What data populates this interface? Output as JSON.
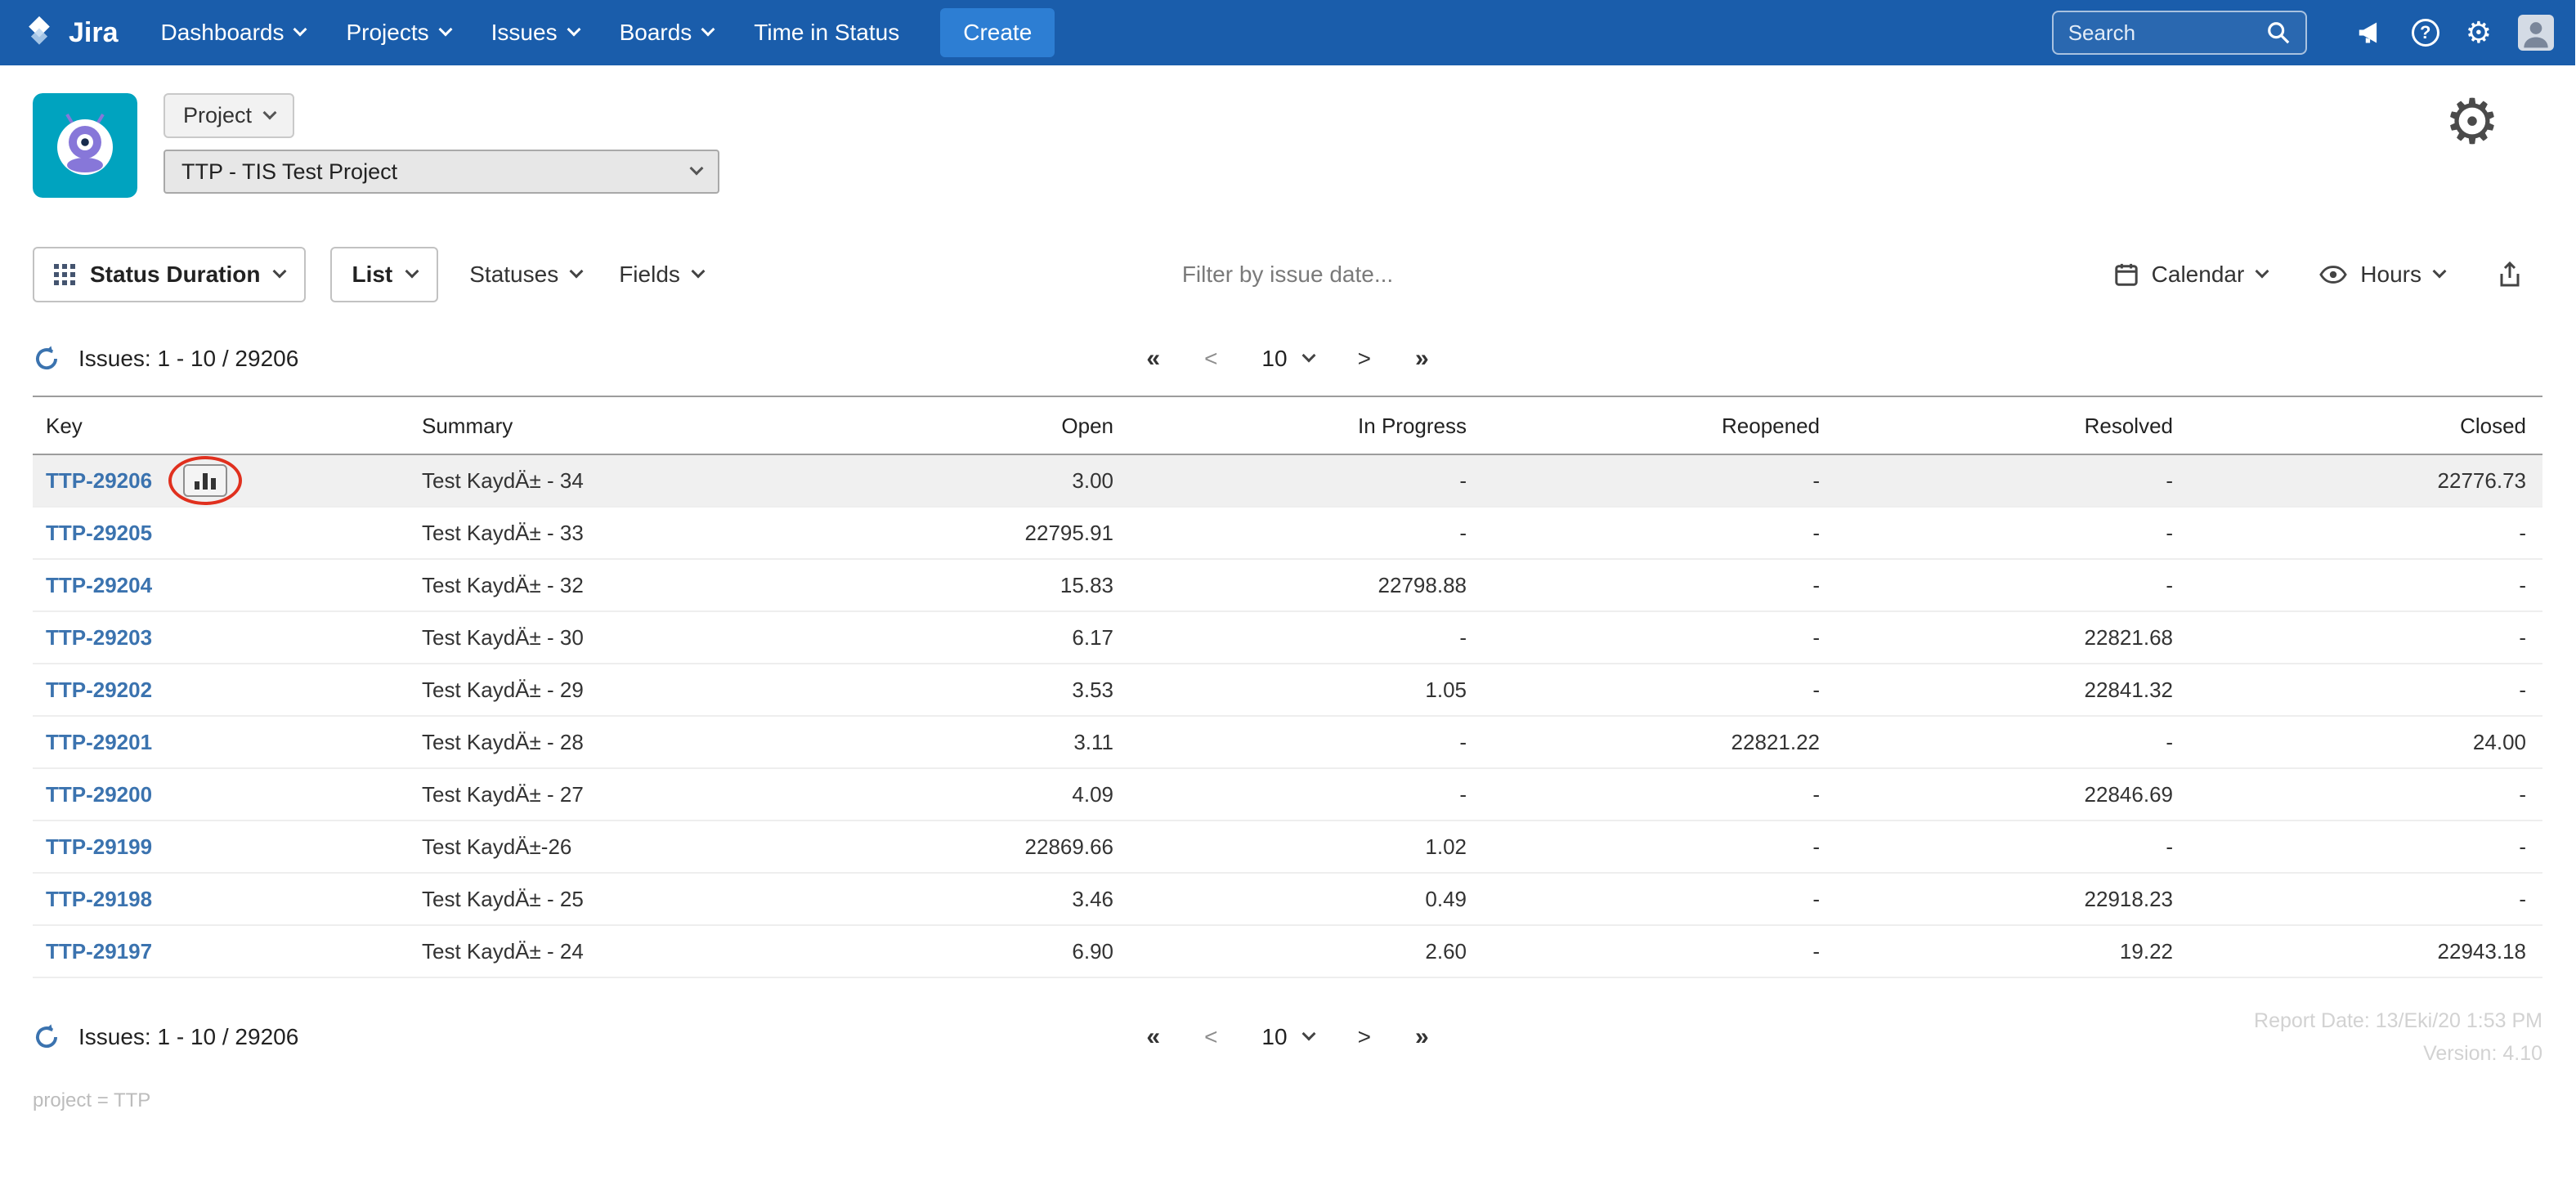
{
  "colors": {
    "navbar_bg": "#1a5dab",
    "create_btn_bg": "#2d7ed3",
    "link": "#3b73af",
    "annotation_red": "#e0301e",
    "row_highlight": "#f0f0f0"
  },
  "navbar": {
    "brand": "Jira",
    "items": [
      {
        "label": "Dashboards"
      },
      {
        "label": "Projects"
      },
      {
        "label": "Issues"
      },
      {
        "label": "Boards"
      },
      {
        "label": "Time in Status"
      }
    ],
    "create_label": "Create",
    "search_placeholder": "Search"
  },
  "icons": {
    "help_glyph": "?",
    "gear_glyph": "⚙",
    "settings_gear_glyph": "⚙"
  },
  "project_header": {
    "scope_label": "Project",
    "selected_project": "TTP - TIS Test Project"
  },
  "toolbar": {
    "report_type": "Status Duration",
    "view": "List",
    "statuses": "Statuses",
    "fields": "Fields",
    "filter_placeholder": "Filter by issue date...",
    "calendar": "Calendar",
    "hours": "Hours"
  },
  "results": {
    "issues_summary": "Issues: 1 - 10 / 29206"
  },
  "pagination": {
    "first": "«",
    "prev": "<",
    "page_size": "10",
    "next": ">",
    "last": "»"
  },
  "table": {
    "columns": [
      "Key",
      "Summary",
      "Open",
      "In Progress",
      "Reopened",
      "Resolved",
      "Closed"
    ],
    "rows": [
      {
        "key": "TTP-29206",
        "summary": "Test KaydÄ± - 34",
        "open": "3.00",
        "in_progress": "-",
        "reopened": "-",
        "resolved": "-",
        "closed": "22776.73",
        "highlighted": true,
        "annotated": true
      },
      {
        "key": "TTP-29205",
        "summary": "Test KaydÄ± - 33",
        "open": "22795.91",
        "in_progress": "-",
        "reopened": "-",
        "resolved": "-",
        "closed": "-"
      },
      {
        "key": "TTP-29204",
        "summary": "Test KaydÄ± - 32",
        "open": "15.83",
        "in_progress": "22798.88",
        "reopened": "-",
        "resolved": "-",
        "closed": "-"
      },
      {
        "key": "TTP-29203",
        "summary": "Test KaydÄ± - 30",
        "open": "6.17",
        "in_progress": "-",
        "reopened": "-",
        "resolved": "22821.68",
        "closed": "-"
      },
      {
        "key": "TTP-29202",
        "summary": "Test KaydÄ± - 29",
        "open": "3.53",
        "in_progress": "1.05",
        "reopened": "-",
        "resolved": "22841.32",
        "closed": "-"
      },
      {
        "key": "TTP-29201",
        "summary": "Test KaydÄ± - 28",
        "open": "3.11",
        "in_progress": "-",
        "reopened": "22821.22",
        "resolved": "-",
        "closed": "24.00"
      },
      {
        "key": "TTP-29200",
        "summary": "Test KaydÄ± - 27",
        "open": "4.09",
        "in_progress": "-",
        "reopened": "-",
        "resolved": "22846.69",
        "closed": "-"
      },
      {
        "key": "TTP-29199",
        "summary": "Test KaydÄ±-26",
        "open": "22869.66",
        "in_progress": "1.02",
        "reopened": "-",
        "resolved": "-",
        "closed": "-"
      },
      {
        "key": "TTP-29198",
        "summary": "Test KaydÄ± - 25",
        "open": "3.46",
        "in_progress": "0.49",
        "reopened": "-",
        "resolved": "22918.23",
        "closed": "-"
      },
      {
        "key": "TTP-29197",
        "summary": "Test KaydÄ± - 24",
        "open": "6.90",
        "in_progress": "2.60",
        "reopened": "-",
        "resolved": "19.22",
        "closed": "22943.18"
      }
    ]
  },
  "footer": {
    "report_date": "Report Date: 13/Eki/20 1:53 PM",
    "version": "Version: 4.10",
    "query": "project = TTP"
  }
}
